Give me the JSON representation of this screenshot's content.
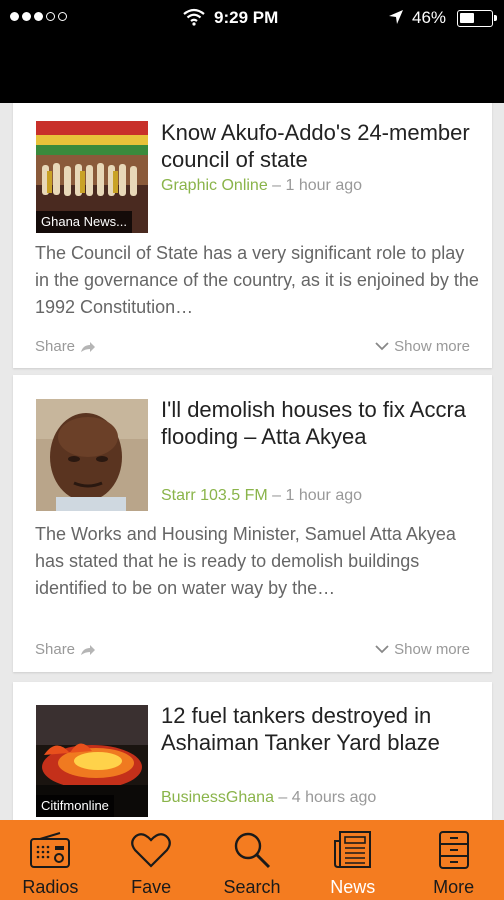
{
  "status_bar": {
    "time": "9:29 PM",
    "battery": "46%"
  },
  "articles": [
    {
      "title": "Know Akufo-Addo's 24-member council of state",
      "thumb_caption": "Ghana News...",
      "source": "Graphic Online",
      "time": "1 hour ago",
      "summary": "The Council of State has a very significant role to play in the governance of the country, as it is enjoined by the 1992 Constitution…",
      "share": "Share",
      "show_more": "Show more"
    },
    {
      "title": "I'll demolish houses to fix Accra flooding – Atta Akyea",
      "thumb_caption": "",
      "source": "Starr 103.5 FM",
      "time": "1 hour ago",
      "summary": "The Works and Housing Minister, Samuel Atta Akyea has stated that he is ready to demolish buildings identified to be on water way by the…",
      "share": "Share",
      "show_more": "Show more"
    },
    {
      "title": "12 fuel tankers destroyed in Ashaiman Tanker Yard blaze",
      "thumb_caption": "Citifmonline",
      "source": "BusinessGhana",
      "time": "4 hours ago"
    }
  ],
  "tabs": [
    {
      "label": "Radios",
      "icon": "radio-icon"
    },
    {
      "label": "Fave",
      "icon": "heart-icon"
    },
    {
      "label": "Search",
      "icon": "search-icon"
    },
    {
      "label": "News",
      "icon": "newspaper-icon",
      "active": true
    },
    {
      "label": "More",
      "icon": "more-icon"
    }
  ],
  "colors": {
    "accent": "#f47c20",
    "source": "#8ab44a",
    "active_tab_label": "#ffffff"
  }
}
